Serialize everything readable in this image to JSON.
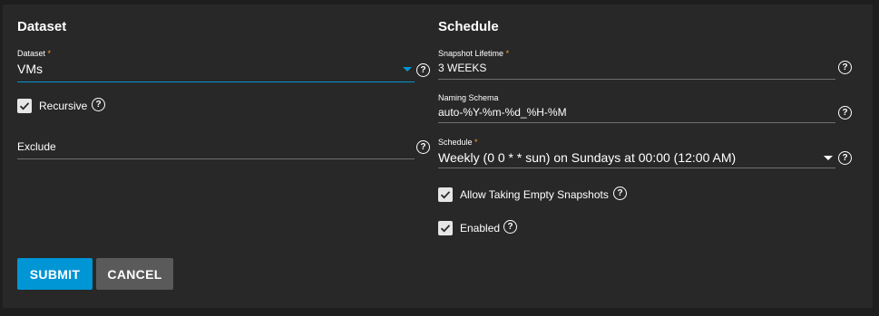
{
  "dataset_section": {
    "title": "Dataset",
    "dataset": {
      "label": "Dataset",
      "required_mark": "*",
      "value": "VMs"
    },
    "recursive": {
      "label": "Recursive",
      "checked": true
    },
    "exclude": {
      "label": "Exclude",
      "value": ""
    }
  },
  "schedule_section": {
    "title": "Schedule",
    "snapshot_lifetime": {
      "label": "Snapshot Lifetime",
      "required_mark": "*",
      "value": "3 WEEKS"
    },
    "naming_schema": {
      "label": "Naming Schema",
      "value": "auto-%Y-%m-%d_%H-%M"
    },
    "schedule": {
      "label": "Schedule",
      "required_mark": "*",
      "value": "Weekly (0 0 * * sun) on Sundays at 00:00 (12:00 AM)"
    },
    "allow_empty": {
      "label": "Allow Taking Empty Snapshots",
      "checked": true
    },
    "enabled": {
      "label": "Enabled",
      "checked": true
    }
  },
  "help_glyph": "?",
  "buttons": {
    "submit": "SUBMIT",
    "cancel": "CANCEL"
  },
  "colors": {
    "accent": "#0095d5",
    "required": "#ff9c2a",
    "card": "#282828",
    "background": "#1e1e1e"
  },
  "icons": {
    "help": "help-circle-icon",
    "check": "check-icon",
    "dropdown": "dropdown-arrow-icon"
  }
}
